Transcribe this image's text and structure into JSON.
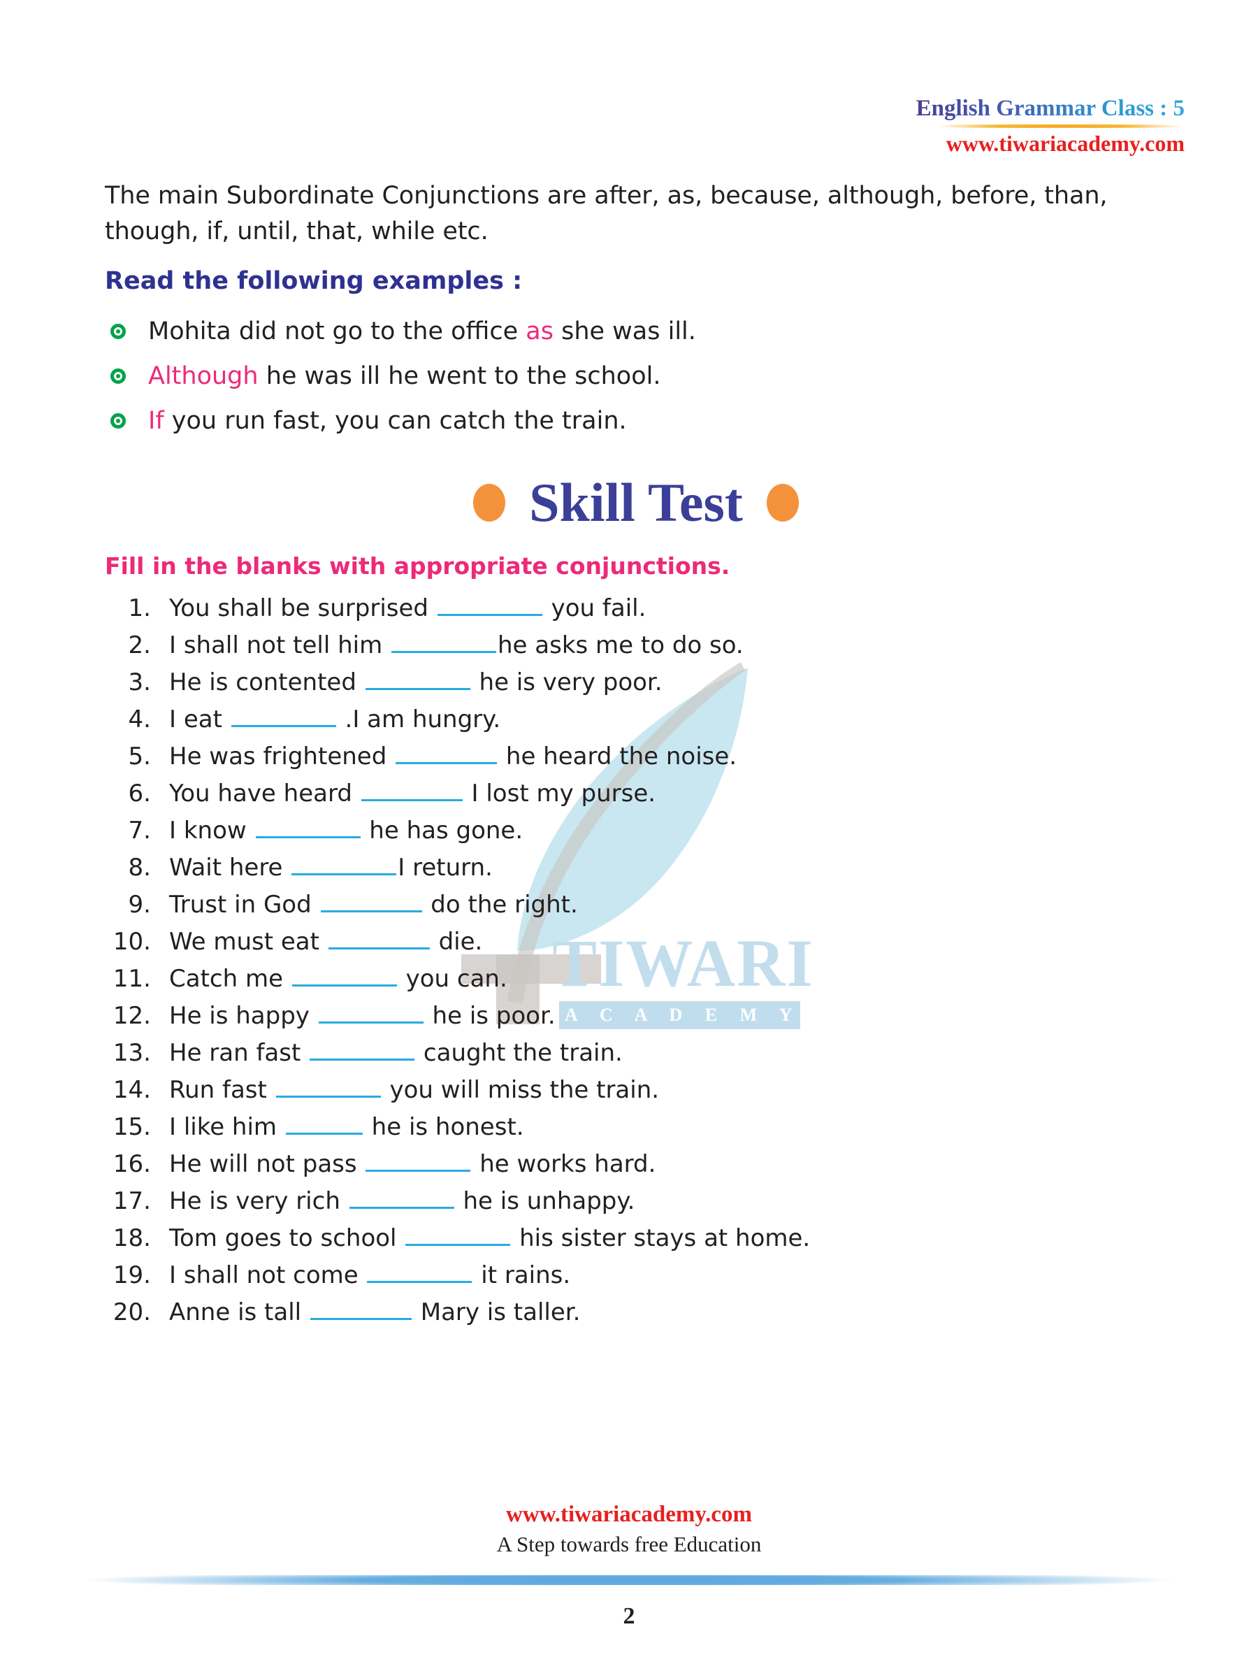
{
  "header": {
    "title": "English Grammar Class : 5",
    "site": "www.tiwariacademy.com"
  },
  "watermark": {
    "brand": "TIWARI",
    "sub": "A C A D E M Y",
    "feather_icon": "feather-quill-icon"
  },
  "body": {
    "intro": "The main Subordinate Conjunctions are after, as, because, although, before, than, though, if, until, that, while etc.",
    "subhead": "Read the following examples :",
    "examples": [
      {
        "pre": "Mohita did not go to the office ",
        "kw": "as",
        "post": " she was ill.",
        "kw_first": false
      },
      {
        "pre": "",
        "kw": "Although",
        "post": " he was ill he went to the school.",
        "kw_first": true
      },
      {
        "pre": "",
        "kw": "If",
        "post": " you run fast, you can catch the train.",
        "kw_first": true
      }
    ]
  },
  "skill_test": {
    "title": "Skill Test",
    "instruction": "Fill in the blanks with appropriate conjunctions.",
    "questions": [
      {
        "n": "1.",
        "pre": "You shall be surprised ",
        "blank": 150,
        "post": " you fail."
      },
      {
        "n": "2.",
        "pre": "I shall not tell him ",
        "blank": 150,
        "post": "he asks me to do so."
      },
      {
        "n": "3.",
        "pre": "He is contented ",
        "blank": 150,
        "post": " he is very poor."
      },
      {
        "n": "4.",
        "pre": "I eat ",
        "blank": 150,
        "post": " .I am hungry."
      },
      {
        "n": "5.",
        "pre": "He was frightened ",
        "blank": 145,
        "post": " he heard the noise."
      },
      {
        "n": "6.",
        "pre": "You have heard ",
        "blank": 145,
        "post": " I lost my purse."
      },
      {
        "n": "7.",
        "pre": "I know ",
        "blank": 150,
        "post": " he has gone."
      },
      {
        "n": "8.",
        "pre": "Wait here ",
        "blank": 150,
        "post": "I return."
      },
      {
        "n": "9.",
        "pre": "Trust in God ",
        "blank": 145,
        "post": " do the right."
      },
      {
        "n": "10.",
        "pre": "We must eat ",
        "blank": 145,
        "post": " die."
      },
      {
        "n": "11.",
        "pre": "Catch me ",
        "blank": 150,
        "post": " you can."
      },
      {
        "n": "12.",
        "pre": "He is happy ",
        "blank": 150,
        "post": " he is poor."
      },
      {
        "n": "13.",
        "pre": "He ran fast ",
        "blank": 150,
        "post": " caught the train."
      },
      {
        "n": "14.",
        "pre": "Run fast ",
        "blank": 150,
        "post": " you will miss the train."
      },
      {
        "n": "15.",
        "pre": "I like him ",
        "blank": 110,
        "post": " he is honest."
      },
      {
        "n": "16.",
        "pre": "He will not pass ",
        "blank": 150,
        "post": " he works hard."
      },
      {
        "n": "17.",
        "pre": "He is very rich ",
        "blank": 150,
        "post": " he is unhappy."
      },
      {
        "n": "18.",
        "pre": "Tom goes to school ",
        "blank": 150,
        "post": " his sister stays at home."
      },
      {
        "n": "19.",
        "pre": "I shall not come ",
        "blank": 150,
        "post": " it rains."
      },
      {
        "n": "20.",
        "pre": "Anne is tall ",
        "blank": 145,
        "post": " Mary is taller."
      }
    ]
  },
  "footer": {
    "site": "www.tiwariacademy.com",
    "tagline": "A Step towards free Education",
    "page": "2"
  }
}
